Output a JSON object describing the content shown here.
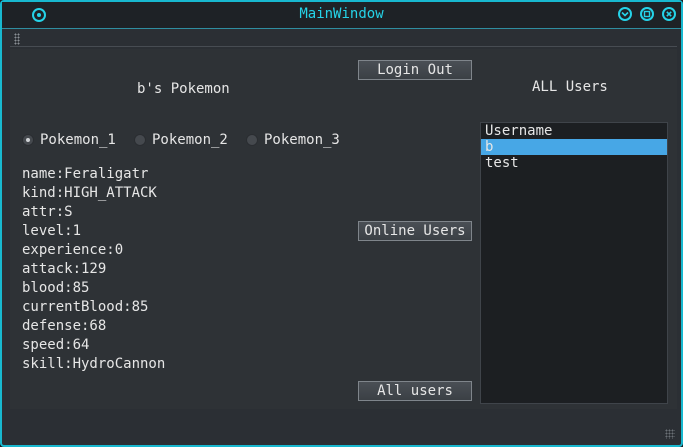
{
  "window": {
    "title": "MainWindow",
    "accent": "#25d3e8"
  },
  "left": {
    "heading": "b's Pokemon",
    "radios": [
      {
        "label": "Pokemon_1",
        "checked": true
      },
      {
        "label": "Pokemon_2",
        "checked": false
      },
      {
        "label": "Pokemon_3",
        "checked": false
      }
    ],
    "stats": [
      "name:Feraligatr",
      "kind:HIGH_ATTACK",
      "attr:S",
      "level:1",
      "experience:0",
      "attack:129",
      "blood:85",
      "currentBlood:85",
      "defense:68",
      "speed:64",
      "skill:HydroCannon"
    ]
  },
  "buttons": {
    "login_out": "Login Out",
    "online_users": "Online Users",
    "all_users": "All users"
  },
  "right": {
    "heading": "ALL Users",
    "list": [
      "Username",
      "b",
      "test"
    ],
    "selected_index": 1
  }
}
